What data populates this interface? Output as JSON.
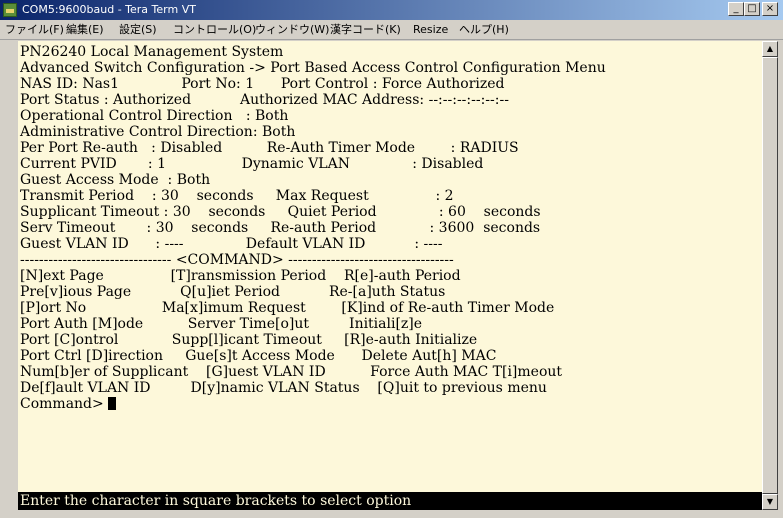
{
  "window": {
    "title": "COM5:9600baud - Tera Term VT",
    "minimize_icon": "minimize-icon",
    "maximize_icon": "maximize-icon",
    "close_icon": "close-icon"
  },
  "menubar": {
    "items": [
      "ファイル(F)",
      "編集(E)",
      "設定(S)",
      "コントロール(O)",
      "ウィンドウ(W)",
      "漢字コード(K)",
      "Resize",
      "ヘルプ(H)"
    ]
  },
  "terminal": {
    "lines": [
      "PN26240 Local Management System",
      "Advanced Switch Configuration -> Port Based Access Control Configuration Menu",
      "NAS ID: Nas1              Port No: 1      Port Control : Force Authorized",
      "Port Status : Authorized           Authorized MAC Address: --:--:--:--:--:--",
      "Operational Control Direction   : Both",
      "Administrative Control Direction: Both",
      "Per Port Re-auth   : Disabled          Re-Auth Timer Mode        : RADIUS",
      "Current PVID       : 1                 Dynamic VLAN              : Disabled",
      "Guest Access Mode  : Both",
      "Transmit Period    : 30    seconds     Max Request               : 2",
      "Supplicant Timeout : 30    seconds     Quiet Period              : 60    seconds",
      "Serv Timeout       : 30    seconds     Re-auth Period            : 3600  seconds",
      "Guest VLAN ID      : ----              Default VLAN ID           : ----",
      "-------------------------------- <COMMAND> -----------------------------------",
      "[N]ext Page               [T]ransmission Period    R[e]-auth Period",
      "Pre[v]ious Page           Q[u]iet Period           Re-[a]uth Status",
      "[P]ort No                 Ma[x]imum Request        [K]ind of Re-auth Timer Mode",
      "Port Auth [M]ode          Server Time[o]ut         Initiali[z]e",
      "Port [C]ontrol            Supp[l]icant Timeout     [R]e-auth Initialize",
      "Port Ctrl [D]irection     Gue[s]t Access Mode      Delete Aut[h] MAC",
      "Num[b]er of Supplicant    [G]uest VLAN ID          Force Auth MAC T[i]meout",
      "De[f]ault VLAN ID         D[y]namic VLAN Status    [Q]uit to previous menu"
    ],
    "prompt": "Command>",
    "status_line": "Enter the character in square brackets to select option"
  },
  "scrollbar": {
    "up_icon": "scroll-up-arrow-icon",
    "down_icon": "scroll-down-arrow-icon"
  }
}
